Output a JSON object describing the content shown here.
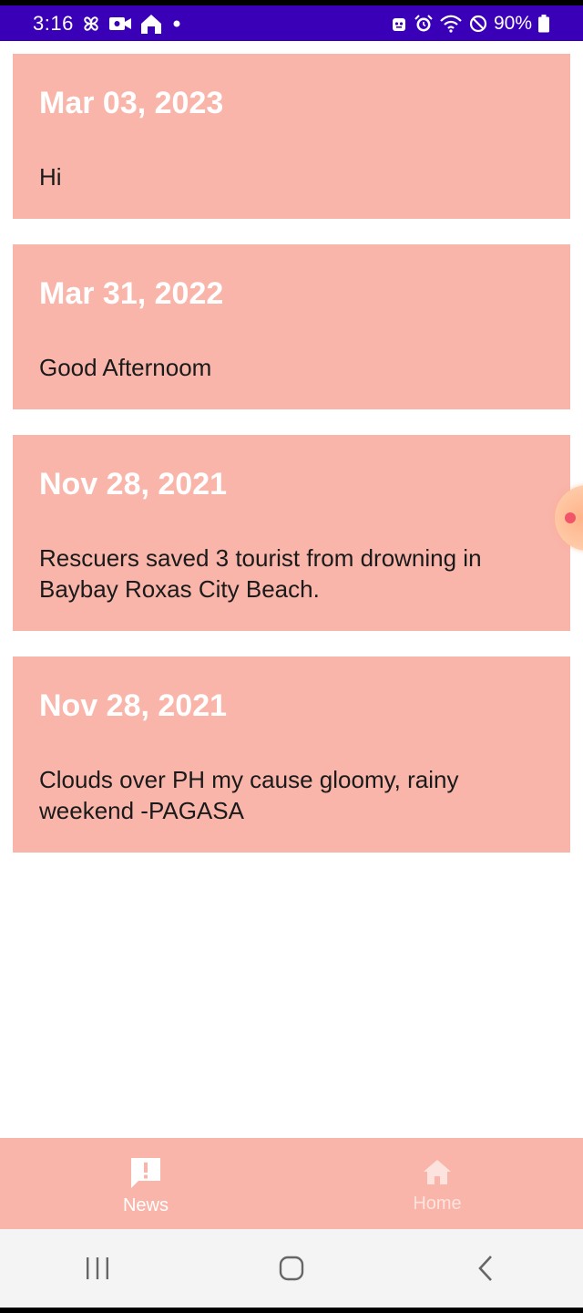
{
  "status_bar": {
    "time": "3:16",
    "left_icons": [
      "pinwheel-icon",
      "video-call-icon",
      "home-shape-icon",
      "dot-icon"
    ],
    "right_icons": [
      "robot-icon",
      "alarm-icon",
      "wifi-icon",
      "do-not-disturb-icon"
    ],
    "battery": "90%",
    "background": "#3a00b8"
  },
  "theme": {
    "card_color": "#f9b5aa",
    "date_color": "#ffffff",
    "body_text_color": "#1a1a1a"
  },
  "news": [
    {
      "date": "Mar 03, 2023",
      "text": "Hi"
    },
    {
      "date": "Mar 31, 2022",
      "text": "Good Afternoom"
    },
    {
      "date": "Nov 28, 2021",
      "text": "Rescuers saved 3 tourist from drowning in Baybay Roxas City Beach."
    },
    {
      "date": "Nov 28, 2021",
      "text": "Clouds over PH my cause gloomy, rainy weekend -PAGASA"
    }
  ],
  "bottom_nav": {
    "items": [
      {
        "label": "News",
        "icon": "announcement-icon",
        "active": true
      },
      {
        "label": "Home",
        "icon": "home-icon",
        "active": false
      }
    ]
  },
  "system_nav": {
    "buttons": [
      "recent-apps-icon",
      "home-circle-icon",
      "back-icon"
    ]
  }
}
